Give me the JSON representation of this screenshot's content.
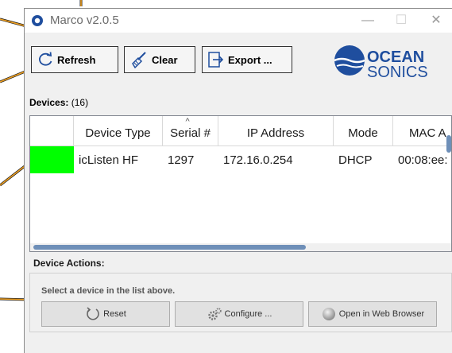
{
  "window": {
    "title": "Marco v2.0.5",
    "minimize_glyph": "—",
    "maximize_glyph": "☐",
    "close_glyph": "✕"
  },
  "toolbar": {
    "refresh_label": "Refresh",
    "clear_label": "Clear",
    "export_label": "Export ..."
  },
  "logo": {
    "line1": "OCEAN",
    "line2": "SONICS",
    "color": "#1f4e9e"
  },
  "devices": {
    "label": "Devices:",
    "count": "(16)"
  },
  "grid": {
    "columns": [
      "",
      "Device Type",
      "Serial #",
      "IP Address",
      "Mode",
      "MAC A"
    ],
    "sort_indicator": "^",
    "rows": [
      {
        "status_color": "#00ff00",
        "device_type": "icListen HF",
        "serial": "1297",
        "ip": "172.16.0.254",
        "mode": "DHCP",
        "mac": "00:08:ee:"
      }
    ]
  },
  "actions": {
    "label": "Device Actions:",
    "hint": "Select a device in the list above.",
    "reset_label": "Reset",
    "configure_label": "Configure ...",
    "browser_label": "Open in Web Browser"
  },
  "colors": {
    "callout": "#f0a020",
    "accent": "#1f4e9e",
    "status_ok": "#00ff00"
  }
}
